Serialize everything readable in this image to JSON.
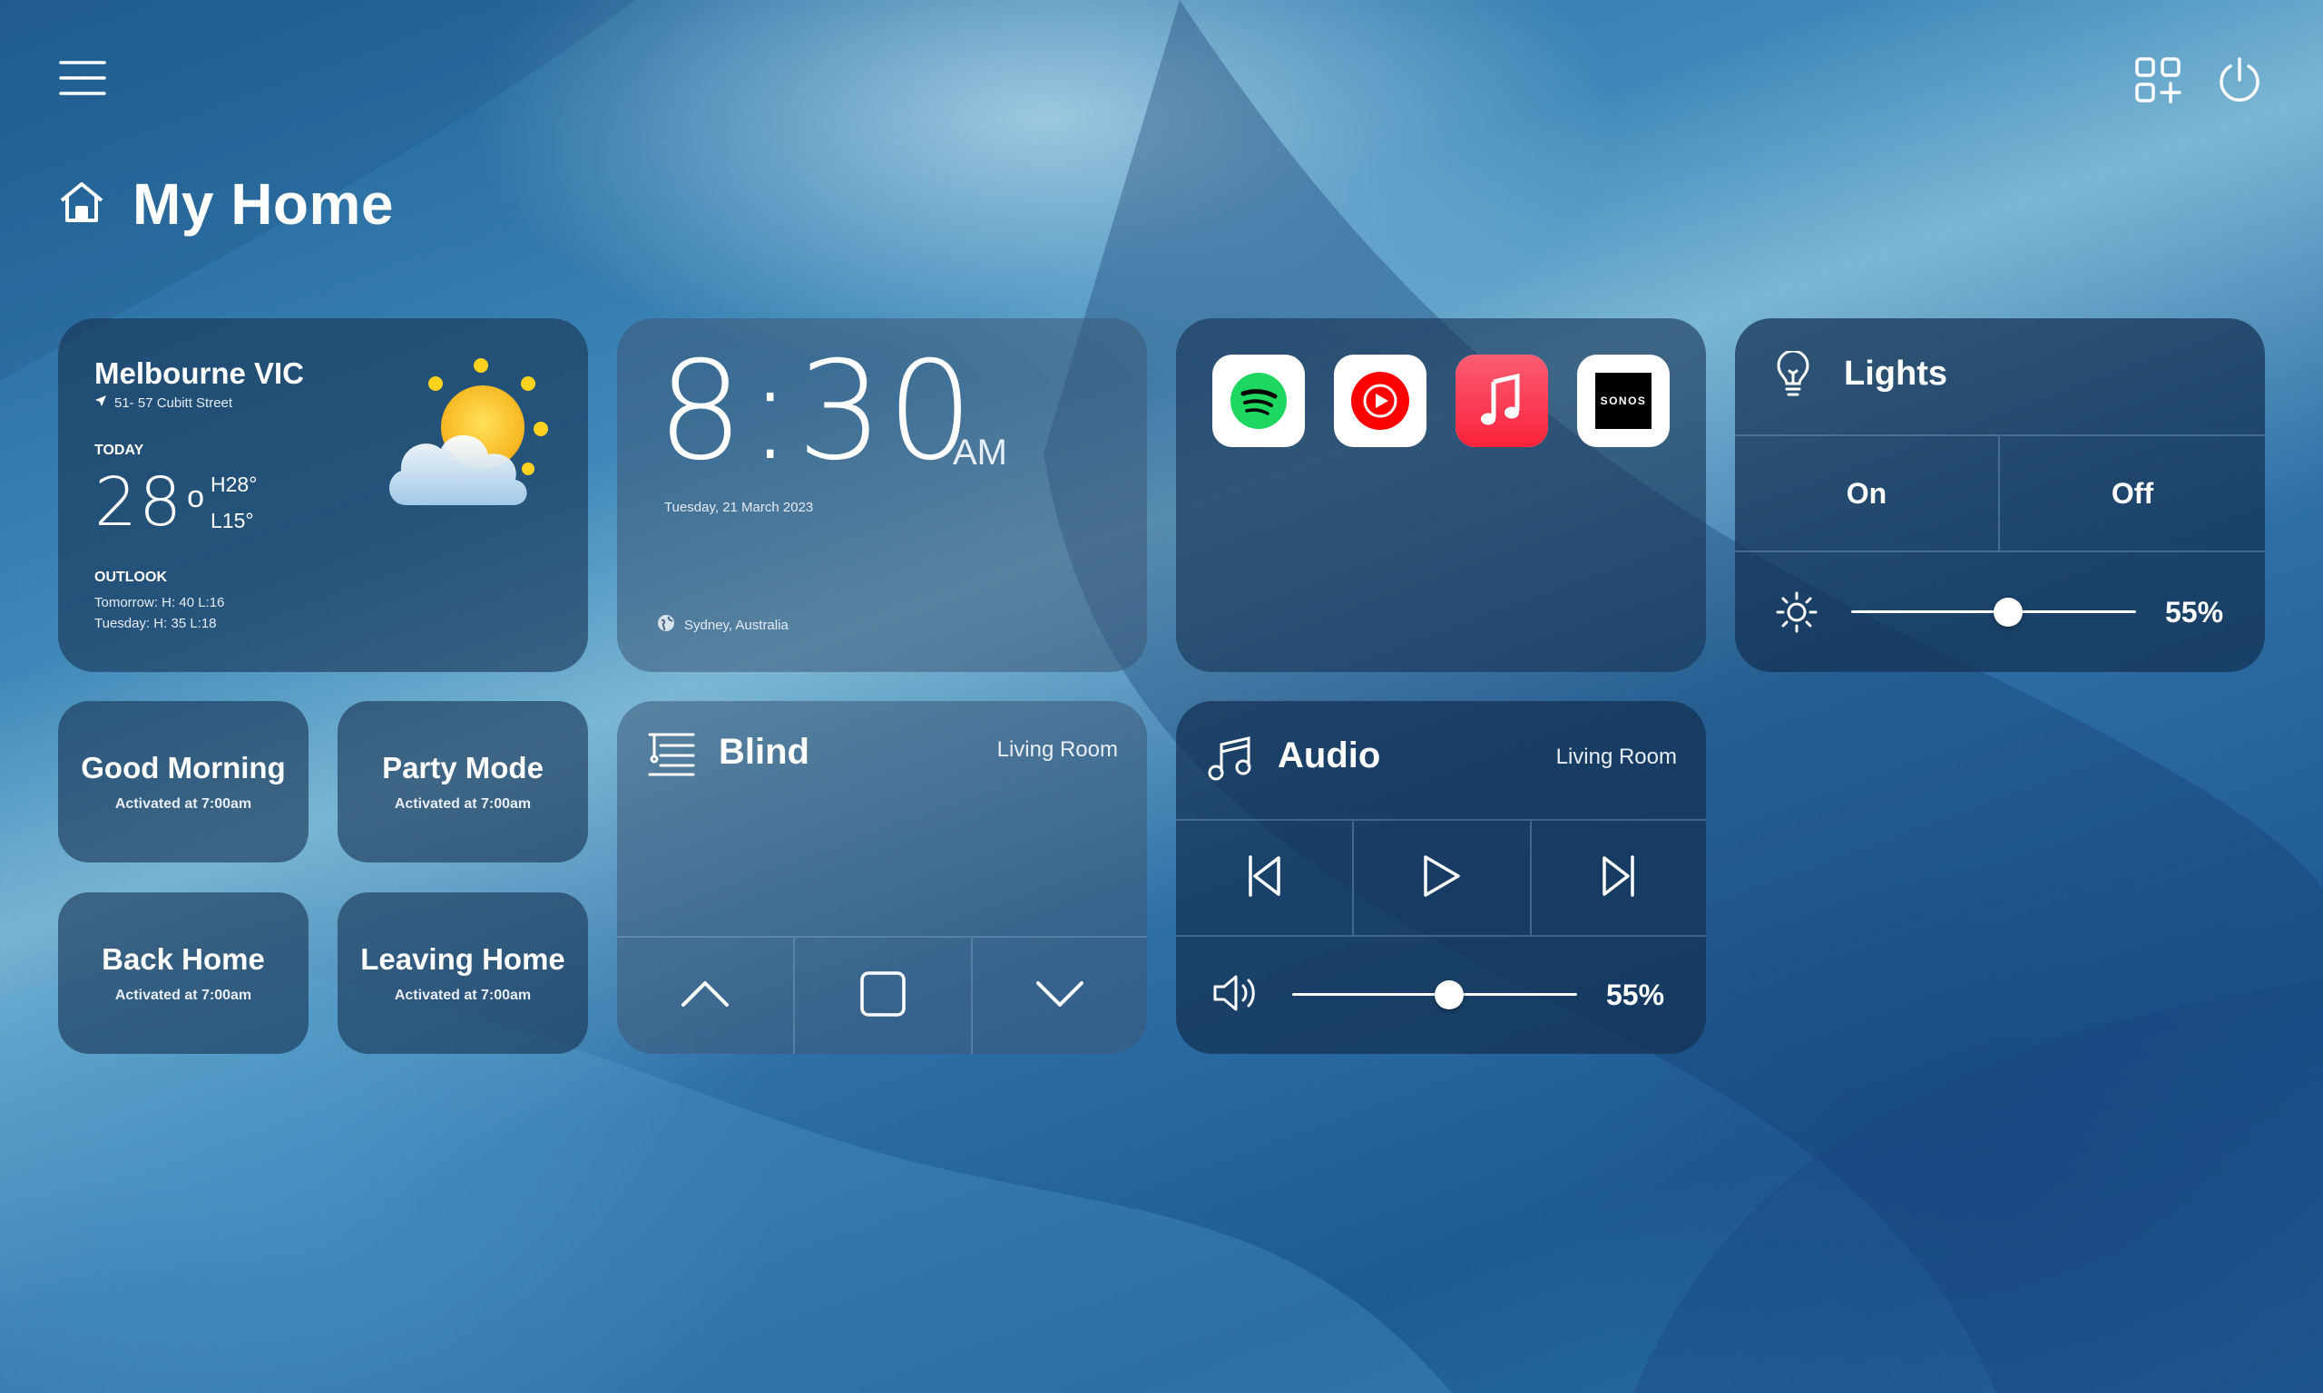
{
  "header": {
    "menu_icon": "hamburger-menu-icon",
    "add_widget_icon": "add-widget-grid-icon",
    "power_icon": "power-icon",
    "home_icon": "home-icon",
    "title": "My Home"
  },
  "weather": {
    "city": "Melbourne VIC",
    "address": "51- 57 Cubitt Street",
    "today_label": "TODAY",
    "temp": "28",
    "deg": "o",
    "high": "H28°",
    "low": "L15°",
    "outlook_label": "OUTLOOK",
    "outlook_1": "Tomorrow: H: 40 L:16",
    "outlook_2": "Tuesday: H: 35 L:18",
    "icon": "partly-cloudy-sun-icon"
  },
  "clock": {
    "time": "8:30",
    "ampm": "AM",
    "date": "Tuesday, 21 March 2023",
    "location": "Sydney, Australia"
  },
  "apps": {
    "items": [
      "spotify-icon",
      "youtube-music-icon",
      "apple-music-icon",
      "sonos-icon"
    ],
    "sonos_label": "SONOS",
    "colors": {
      "spotify": "#1ED760",
      "youtube": "#FF0000",
      "apple_music": "#FA3C52",
      "sonos": "#000000"
    }
  },
  "lights": {
    "title": "Lights",
    "on_label": "On",
    "off_label": "Off",
    "brightness": 0.55,
    "brightness_label": "55%"
  },
  "scenes": [
    {
      "name": "Good Morning",
      "status": "Activated at 7:00am"
    },
    {
      "name": "Party Mode",
      "status": "Activated at 7:00am"
    },
    {
      "name": "Back Home",
      "status": "Activated at 7:00am"
    },
    {
      "name": "Leaving Home",
      "status": "Activated at 7:00am"
    }
  ],
  "blind": {
    "title": "Blind",
    "room": "Living Room",
    "controls": [
      "chevron-up-icon",
      "stop-square-icon",
      "chevron-down-icon"
    ]
  },
  "audio": {
    "title": "Audio",
    "room": "Living Room",
    "controls": [
      "skip-back-icon",
      "play-icon",
      "skip-forward-icon"
    ],
    "volume": 0.55,
    "volume_label": "55%"
  }
}
